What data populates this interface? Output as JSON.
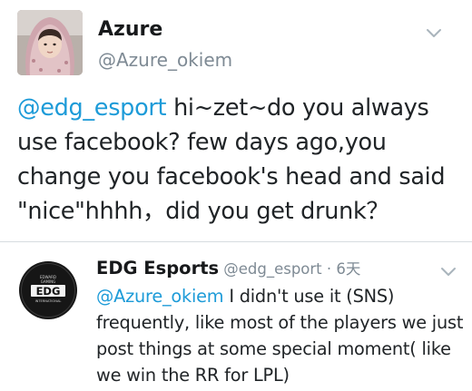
{
  "tweet": {
    "author_name": "Azure",
    "author_handle": "@Azure_okiem",
    "mention": "@edg_esport",
    "text": " hi~zet~do you always use facebook? few days ago,you change you facebook's head and said \"nice\"hhhh，did you get drunk？",
    "avatar_icon": "profile-photo",
    "menu_icon": "chevron-down-icon"
  },
  "reply": {
    "author_name": "EDG Esports",
    "author_handle": "@edg_esport",
    "separator": " · ",
    "time": "6天",
    "mention": "@Azure_okiem",
    "text": " I didn't use it (SNS) frequently, like most of the players we just post things at some special moment( like we win the RR for LPL)",
    "avatar_icon": "edg-logo",
    "logo": {
      "top_text": "EDWARD",
      "top_text2": "GAMING",
      "main_text": "EDG",
      "bottom_text": "INTERNATIONAL"
    },
    "menu_icon": "chevron-down-icon"
  },
  "colors": {
    "link": "#1d9bd8",
    "meta": "#7e8a94",
    "text": "#202427",
    "divider": "#d7dce0"
  }
}
